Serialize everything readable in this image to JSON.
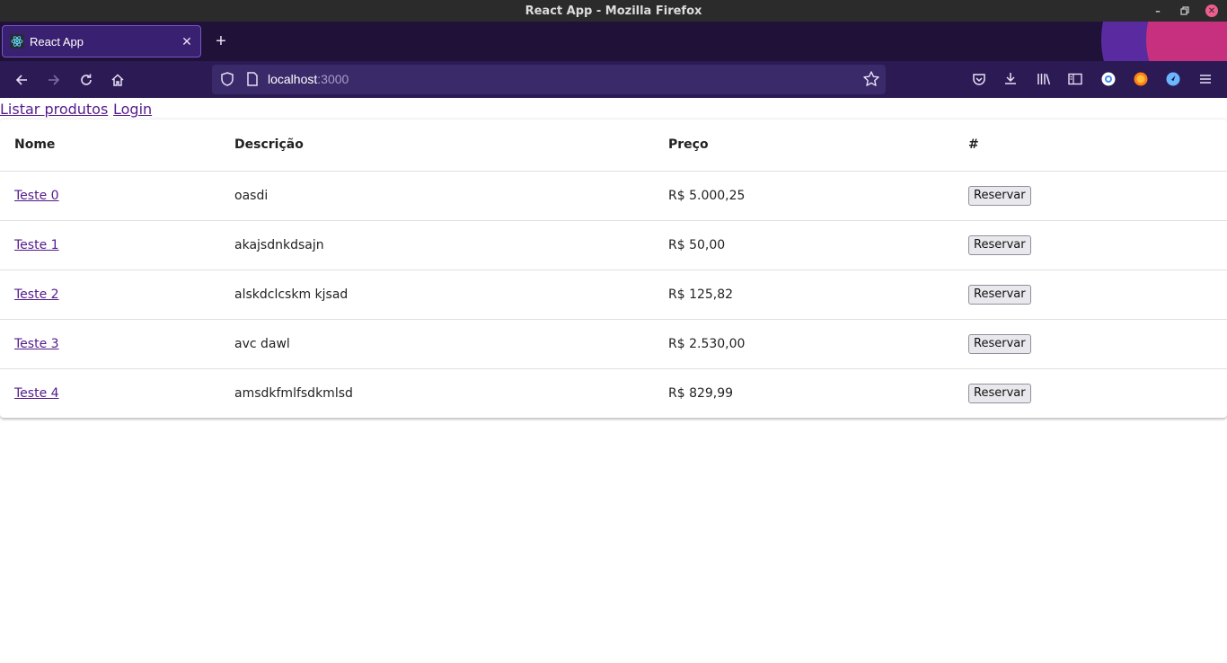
{
  "window": {
    "title": "React App - Mozilla Firefox"
  },
  "browser": {
    "tabs": [
      {
        "label": "React App",
        "active": true
      }
    ],
    "url": {
      "host": "localhost",
      "port": ":3000"
    },
    "accent_color": "#2b1a54"
  },
  "page": {
    "nav": {
      "listar_label": "Listar produtos",
      "login_label": "Login"
    },
    "table": {
      "headers": [
        "Nome",
        "Descrição",
        "Preço",
        "#"
      ],
      "rows": [
        {
          "nome": "Teste 0",
          "descricao": "oasdi",
          "preco": "R$ 5.000,25",
          "action": "Reservar"
        },
        {
          "nome": "Teste 1",
          "descricao": "akajsdnkdsajn",
          "preco": "R$ 50,00",
          "action": "Reservar"
        },
        {
          "nome": "Teste 2",
          "descricao": "alskdclcskm kjsad",
          "preco": "R$ 125,82",
          "action": "Reservar"
        },
        {
          "nome": "Teste 3",
          "descricao": "avc dawl",
          "preco": "R$ 2.530,00",
          "action": "Reservar"
        },
        {
          "nome": "Teste 4",
          "descricao": "amsdkfmlfsdkmlsd",
          "preco": "R$ 829,99",
          "action": "Reservar"
        }
      ]
    }
  }
}
